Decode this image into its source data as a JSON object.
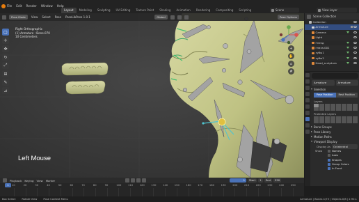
{
  "menubar": {
    "items": [
      "File",
      "Edit",
      "Render",
      "Window",
      "Help"
    ],
    "workspaces": [
      "Layout",
      "Modeling",
      "Sculpting",
      "UV Editing",
      "Texture Paint",
      "Shading",
      "Animation",
      "Rendering",
      "Compositing",
      "Scripting"
    ],
    "active_workspace": "Layout",
    "scene": "Scene",
    "view_layer": "View Layer"
  },
  "viewport": {
    "mode": "Pose Mode",
    "menus": [
      "View",
      "Select",
      "Pose"
    ],
    "pose_lib": "PoseLibPose 1.0.1",
    "transform_orientation": "Global",
    "pose_options": "Pose Options",
    "overlay": {
      "line1": "Right Orthographic",
      "line2": "(1) Armature : Bone.070",
      "line3": "10 Centimeters"
    },
    "left_mouse_label": "Left Mouse"
  },
  "outliner": {
    "header": "Scene Collection",
    "rows": [
      {
        "label": "Collection",
        "selected": false
      },
      {
        "label": "Armature",
        "selected": true
      },
      {
        "label": "Camera",
        "selected": false
      },
      {
        "label": "Light",
        "selected": false
      },
      {
        "label": "Гнезд",
        "selected": false
      },
      {
        "label": "глаза.001",
        "selected": false
      },
      {
        "label": "зубы1",
        "selected": false
      },
      {
        "label": "зубы2",
        "selected": false
      },
      {
        "label": "Head_sculptura",
        "selected": false
      }
    ]
  },
  "properties": {
    "object_name": "Armature",
    "data_name": "Armature",
    "sections": {
      "skeleton": "Skeleton",
      "pose_position": "Pose Position",
      "rest_position": "Rest Position",
      "layers": "Layers",
      "protected_layers": "Protected Layers",
      "bone_groups": "Bone Groups",
      "pose_library": "Pose Library",
      "motion_paths": "Motion Paths",
      "viewport_display": "Viewport Display"
    },
    "display_as_label": "Display As",
    "display_as_value": "Octahedral",
    "show_label": "Show",
    "show_options": [
      {
        "label": "Names",
        "checked": false
      },
      {
        "label": "Axes",
        "checked": false
      },
      {
        "label": "Shapes",
        "checked": true
      },
      {
        "label": "Group Colors",
        "checked": true
      },
      {
        "label": "In Front",
        "checked": true
      }
    ]
  },
  "timeline": {
    "menus": [
      "Playback",
      "Keying",
      "View",
      "Marker"
    ],
    "current_frame": "1",
    "start_label": "Start",
    "start_value": "1",
    "end_label": "End",
    "end_value": "250",
    "ticks": [
      "10",
      "20",
      "30",
      "40",
      "50",
      "60",
      "70",
      "80",
      "90",
      "100",
      "110",
      "120",
      "130",
      "140",
      "150",
      "160",
      "170",
      "180",
      "190",
      "200",
      "210",
      "220",
      "230",
      "240",
      "250"
    ],
    "playhead": "1"
  },
  "statusbar": {
    "items": [
      "Box Select",
      "Rotate View",
      "Pose Context Menu"
    ],
    "right": "Armature | Bones:1/73 | Objects:0/8 | 2.90.1"
  },
  "colors": {
    "accent": "#4a72b8",
    "selected_row": "#334d80",
    "bone": "#9a9a9a",
    "skin": "#c9cc8f"
  }
}
